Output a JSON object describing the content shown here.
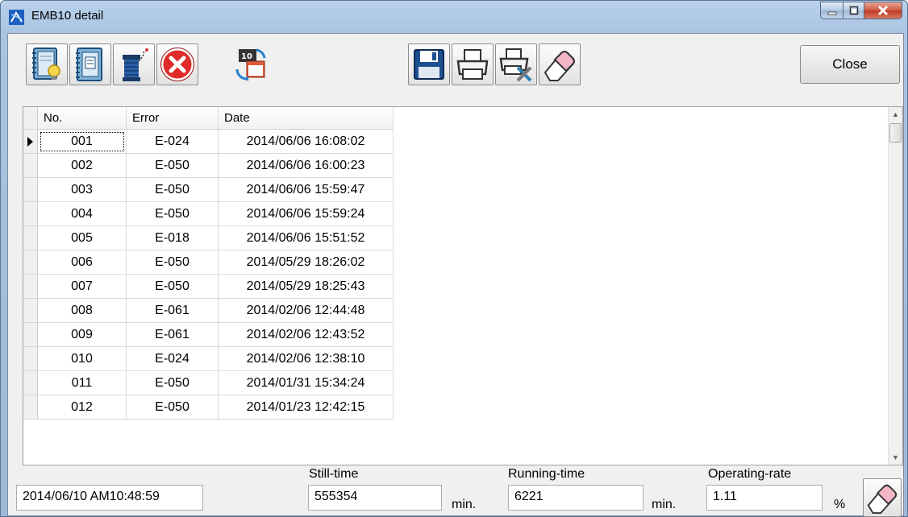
{
  "window": {
    "title": "EMB10 detail"
  },
  "toolbar": {
    "buttons": [
      {
        "name": "notebook-bulb-button",
        "icon": "notebook-lightbulb-icon"
      },
      {
        "name": "notebook-button",
        "icon": "notebook-icon"
      },
      {
        "name": "thread-spool-button",
        "icon": "thread-spool-icon"
      },
      {
        "name": "error-button",
        "icon": "red-x-circle-icon"
      },
      {
        "name": "calendar-sync-button",
        "icon": "calendar-refresh-icon",
        "badge": "10"
      },
      {
        "name": "save-button",
        "icon": "floppy-disk-icon"
      },
      {
        "name": "print-button",
        "icon": "printer-icon"
      },
      {
        "name": "print-setup-button",
        "icon": "printer-tools-icon"
      },
      {
        "name": "clear-button",
        "icon": "eraser-icon"
      }
    ],
    "close_label": "Close"
  },
  "table": {
    "columns": [
      "No.",
      "Error",
      "Date"
    ],
    "rows": [
      {
        "no": "001",
        "error": "E-024",
        "date": "2014/06/06 16:08:02"
      },
      {
        "no": "002",
        "error": "E-050",
        "date": "2014/06/06 16:00:23"
      },
      {
        "no": "003",
        "error": "E-050",
        "date": "2014/06/06 15:59:47"
      },
      {
        "no": "004",
        "error": "E-050",
        "date": "2014/06/06 15:59:24"
      },
      {
        "no": "005",
        "error": "E-018",
        "date": "2014/06/06 15:51:52"
      },
      {
        "no": "006",
        "error": "E-050",
        "date": "2014/05/29 18:26:02"
      },
      {
        "no": "007",
        "error": "E-050",
        "date": "2014/05/29 18:25:43"
      },
      {
        "no": "008",
        "error": "E-061",
        "date": "2014/02/06 12:44:48"
      },
      {
        "no": "009",
        "error": "E-061",
        "date": "2014/02/06 12:43:52"
      },
      {
        "no": "010",
        "error": "E-024",
        "date": "2014/02/06 12:38:10"
      },
      {
        "no": "011",
        "error": "E-050",
        "date": "2014/01/31 15:34:24"
      },
      {
        "no": "012",
        "error": "E-050",
        "date": "2014/01/23 12:42:15"
      }
    ]
  },
  "status": {
    "timestamp": "2014/06/10  AM10:48:59",
    "still_time_label": "Still-time",
    "still_time_value": "555354",
    "still_time_unit": "min.",
    "running_time_label": "Running-time",
    "running_time_value": "6221",
    "running_time_unit": "min.",
    "operating_rate_label": "Operating-rate",
    "operating_rate_value": "1.11",
    "operating_rate_unit": "%"
  }
}
